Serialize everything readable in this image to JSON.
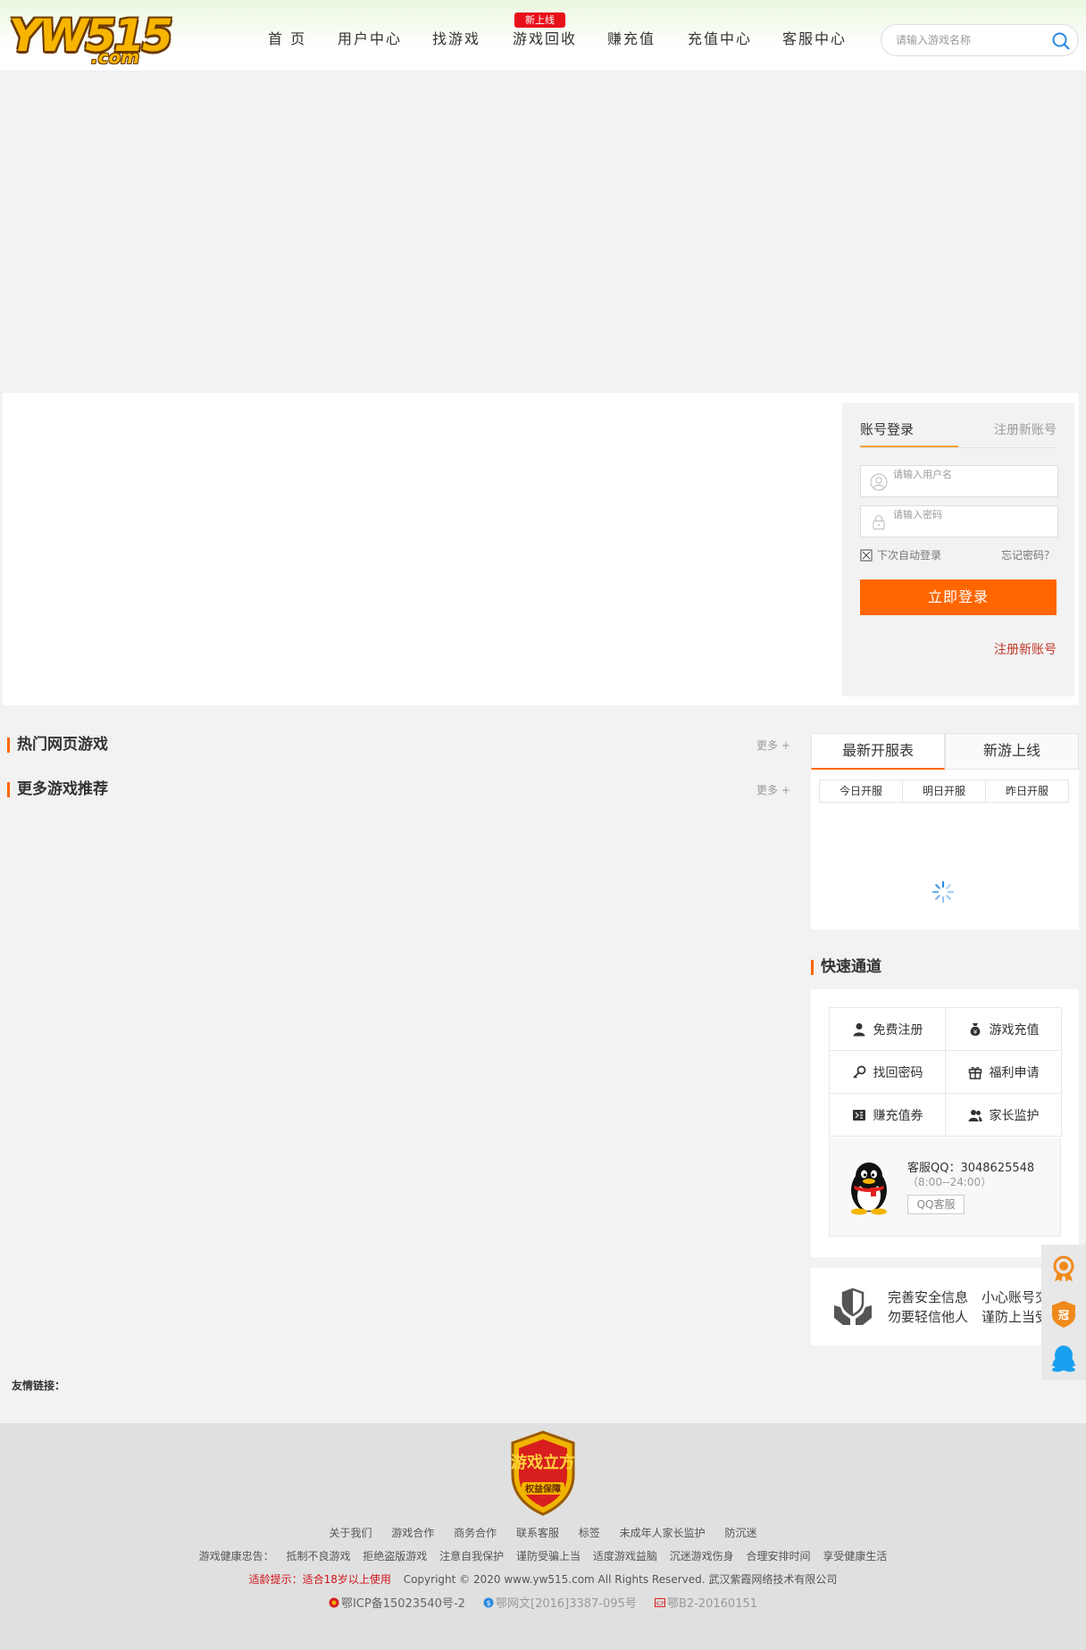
{
  "header": {
    "logo": "YW515.com",
    "nav": [
      {
        "label": "首 页"
      },
      {
        "label": "用户中心"
      },
      {
        "label": "找游戏"
      },
      {
        "label": "游戏回收",
        "badge": "新上线"
      },
      {
        "label": "赚充值"
      },
      {
        "label": "充值中心"
      },
      {
        "label": "客服中心"
      }
    ],
    "search_placeholder": "请输入游戏名称"
  },
  "login": {
    "tab_active": "账号登录",
    "tab_register": "注册新账号",
    "username_placeholder": "请输入用户名",
    "password_placeholder": "请输入密码",
    "auto_login": "下次自动登录",
    "forgot": "忘记密码？",
    "submit": "立即登录",
    "register_link": "注册新账号"
  },
  "sections": {
    "hot_games": "热门网页游戏",
    "more_games": "更多游戏推荐",
    "more": "更多 +"
  },
  "servers": {
    "tabs": [
      "最新开服表",
      "新游上线"
    ],
    "days": [
      "今日开服",
      "明日开服",
      "昨日开服"
    ]
  },
  "quick": {
    "title": "快速通道",
    "items": [
      {
        "label": "免费注册",
        "icon": "user-icon"
      },
      {
        "label": "游戏充值",
        "icon": "money-bag-icon"
      },
      {
        "label": "找回密码",
        "icon": "key-icon"
      },
      {
        "label": "福利申请",
        "icon": "gift-icon"
      },
      {
        "label": "赚充值券",
        "icon": "ticket-icon"
      },
      {
        "label": "家长监护",
        "icon": "users-icon"
      }
    ],
    "qq_label": "客服QQ：3048625548",
    "qq_time": "（8:00--24:00）",
    "qq_button": "QQ客服"
  },
  "safety": {
    "col1": [
      "完善安全信息",
      "勿要轻信他人"
    ],
    "col2": [
      "小心账号交易",
      "谨防上当受骗"
    ]
  },
  "friend_links": "友情链接：",
  "footer": {
    "badge_text": "游戏立方",
    "badge_sub": "权益保障",
    "links": [
      "关于我们",
      "游戏合作",
      "商务合作",
      "联系客服",
      "标签",
      "未成年人家长监护",
      "防沉迷"
    ],
    "health_label": "游戏健康忠告：",
    "health": [
      "抵制不良游戏",
      "拒绝盗版游戏",
      "注意自我保护",
      "谨防受骗上当",
      "适度游戏益脑",
      "沉迷游戏伤身",
      "合理安排时间",
      "享受健康生活"
    ],
    "age_notice": "适龄提示：适合18岁以上使用",
    "copyright": "Copyright © 2020 www.yw515.com All Rights Reserved.  武汉紫霞网络技术有限公司",
    "icp": "鄂ICP备15023540号-2",
    "wenwang": "鄂网文[2016]3387-095号",
    "b2": "鄂B2-20160151"
  },
  "colors": {
    "accent": "#ff6600",
    "badge_red": "#e8111a",
    "link_red": "#c0392b"
  }
}
